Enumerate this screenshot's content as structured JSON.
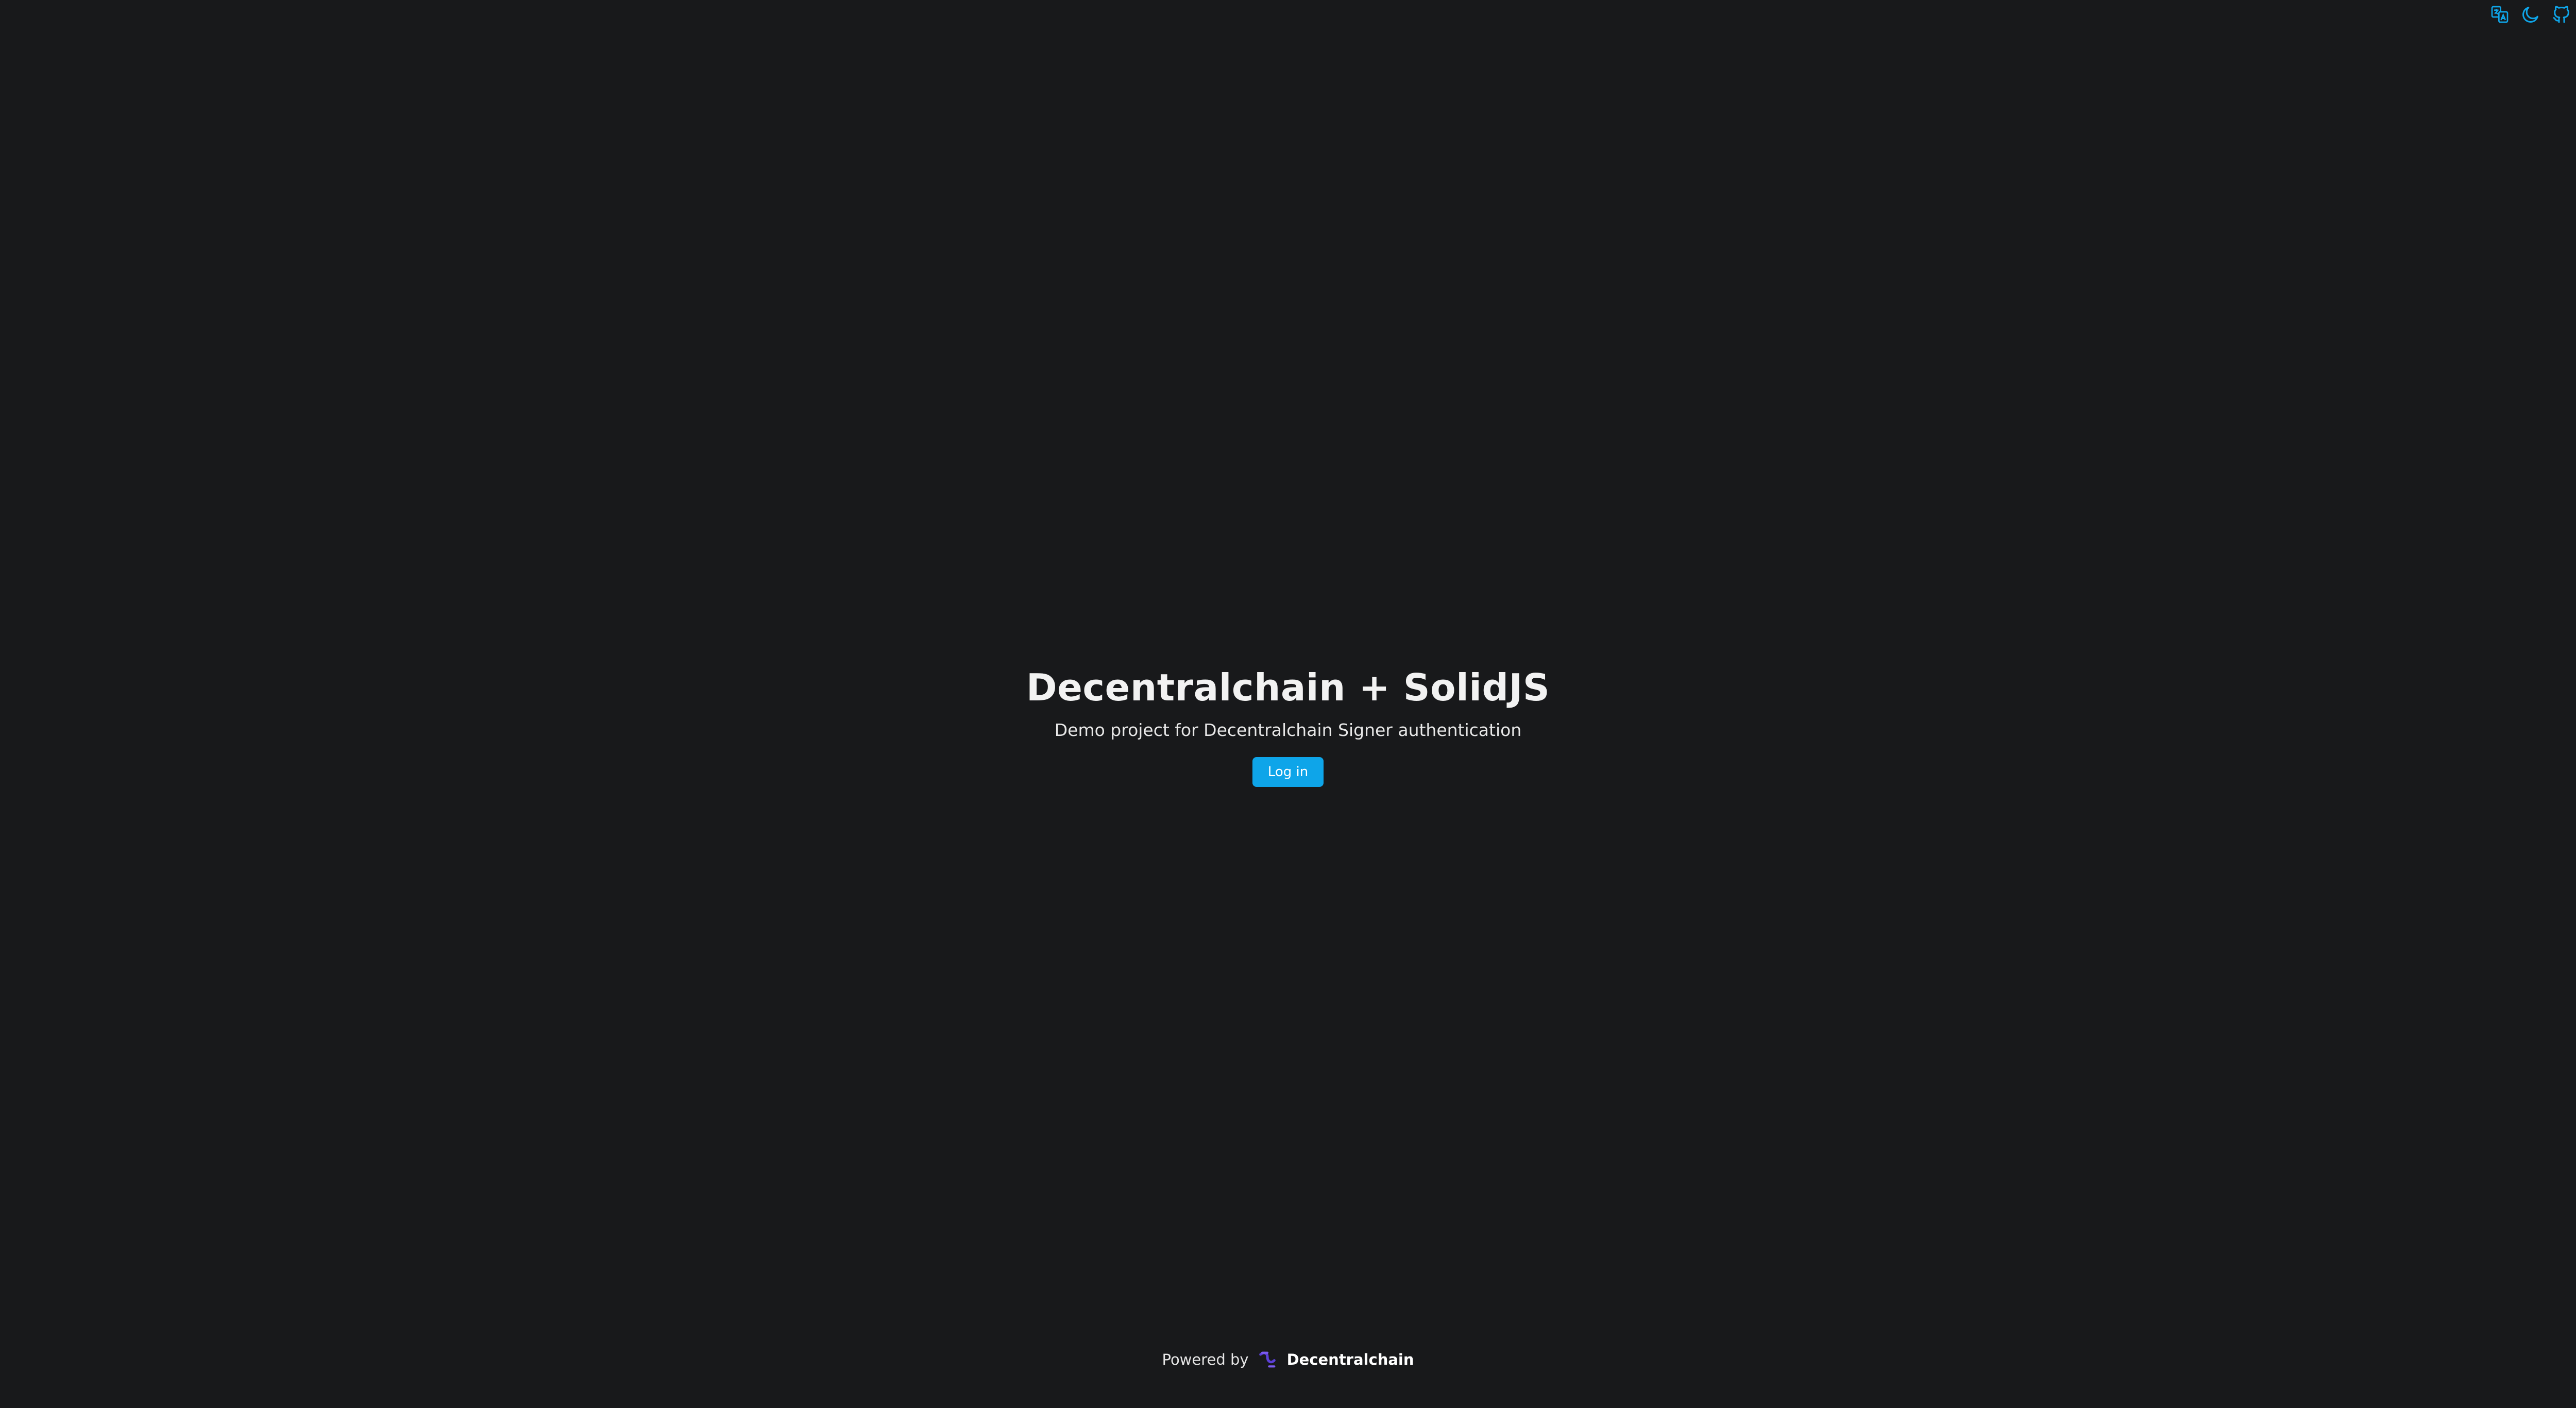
{
  "header": {
    "icons": [
      {
        "name": "translate-icon",
        "color": "#0ea5e9"
      },
      {
        "name": "moon-icon",
        "color": "#0ea5e9"
      },
      {
        "name": "github-icon",
        "color": "#0ea5e9"
      }
    ]
  },
  "hero": {
    "title": "Decentralchain + SolidJS",
    "subtitle": "Demo project for Decentralchain Signer authentication",
    "login_label": "Log in"
  },
  "footer": {
    "powered_by": "Powered by",
    "brand_name": "Decentralchain",
    "brand_logo": "decentralchain-logo"
  },
  "colors": {
    "background": "#18191b",
    "accent": "#0ea5e9",
    "logo": "#5b3fd6"
  }
}
